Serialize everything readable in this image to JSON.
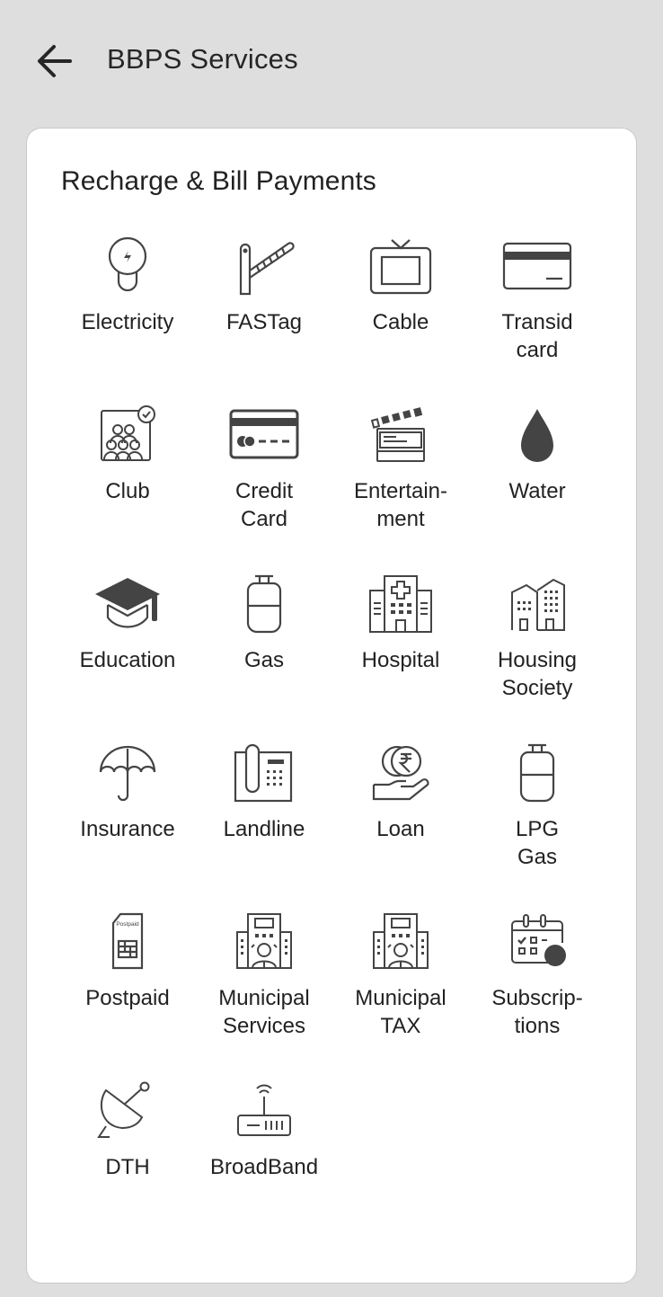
{
  "header": {
    "back_icon": "arrow-left-icon",
    "title": "BBPS Services"
  },
  "section": {
    "title": "Recharge & Bill Payments"
  },
  "services": [
    {
      "label": "Electricity",
      "icon": "bulb-icon"
    },
    {
      "label": "FASTag",
      "icon": "toll-barrier-icon"
    },
    {
      "label": "Cable",
      "icon": "tv-icon"
    },
    {
      "label": "Transid\ncard",
      "icon": "card-icon"
    },
    {
      "label": "Club",
      "icon": "club-group-icon"
    },
    {
      "label": "Credit\nCard",
      "icon": "credit-card-icon"
    },
    {
      "label": "Entertain-\nment",
      "icon": "clapperboard-icon"
    },
    {
      "label": "Water",
      "icon": "water-drop-icon"
    },
    {
      "label": "Education",
      "icon": "graduation-cap-icon"
    },
    {
      "label": "Gas",
      "icon": "gas-cylinder-icon"
    },
    {
      "label": "Hospital",
      "icon": "hospital-icon"
    },
    {
      "label": "Housing\nSociety",
      "icon": "buildings-icon"
    },
    {
      "label": "Insurance",
      "icon": "umbrella-icon"
    },
    {
      "label": "Landline",
      "icon": "telephone-icon"
    },
    {
      "label": "Loan",
      "icon": "rupee-hand-icon"
    },
    {
      "label": "LPG\nGas",
      "icon": "lpg-cylinder-icon"
    },
    {
      "label": "Postpaid",
      "icon": "postpaid-sim-icon",
      "icon_text": "Postpaid"
    },
    {
      "label": "Municipal\nServices",
      "icon": "municipal-building-icon"
    },
    {
      "label": "Municipal\nTAX",
      "icon": "municipal-tax-icon"
    },
    {
      "label": "Subscrip-\ntions",
      "icon": "calendar-subscription-icon"
    },
    {
      "label": "DTH",
      "icon": "satellite-dish-icon"
    },
    {
      "label": "BroadBand",
      "icon": "router-icon"
    }
  ]
}
